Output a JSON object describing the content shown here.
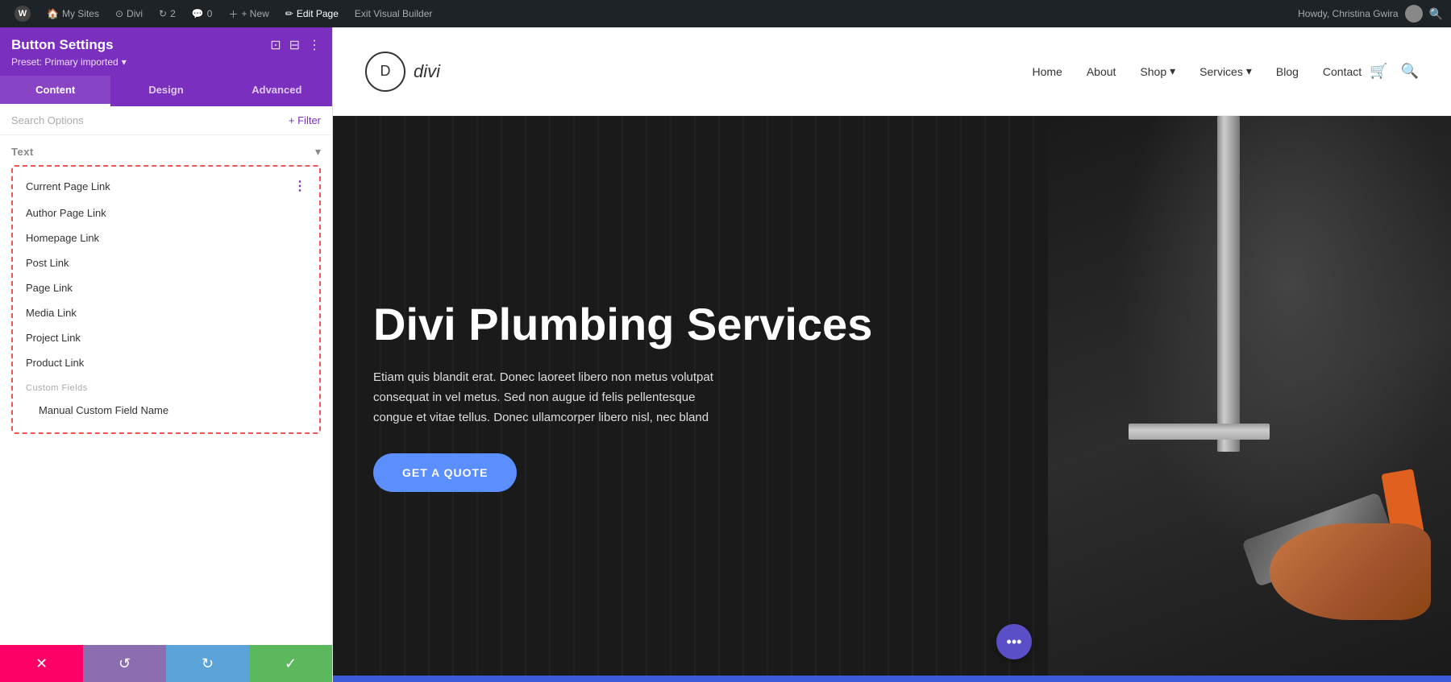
{
  "adminBar": {
    "wpLogo": "W",
    "items": [
      {
        "label": "My Sites",
        "icon": "house"
      },
      {
        "label": "Divi",
        "icon": "divi"
      },
      {
        "label": "2",
        "icon": "loop"
      },
      {
        "label": "0",
        "icon": "comment"
      },
      {
        "label": "+ New",
        "icon": "plus"
      },
      {
        "label": "Edit Page",
        "icon": "pencil"
      },
      {
        "label": "Exit Visual Builder",
        "icon": ""
      }
    ],
    "rightText": "Howdy, Christina Gwira"
  },
  "panel": {
    "title": "Button Settings",
    "preset": "Preset: Primary imported",
    "tabs": [
      {
        "label": "Content",
        "active": true
      },
      {
        "label": "Design",
        "active": false
      },
      {
        "label": "Advanced",
        "active": false
      }
    ],
    "searchPlaceholder": "Search Options",
    "filterLabel": "+ Filter",
    "textSection": {
      "label": "Text",
      "items": [
        {
          "label": "Current Page Link",
          "hasIcon": true
        },
        {
          "label": "Author Page Link",
          "hasIcon": false
        },
        {
          "label": "Homepage Link",
          "hasIcon": false
        },
        {
          "label": "Post Link",
          "hasIcon": false
        },
        {
          "label": "Page Link",
          "hasIcon": false
        },
        {
          "label": "Media Link",
          "hasIcon": false
        },
        {
          "label": "Project Link",
          "hasIcon": false
        },
        {
          "label": "Product Link",
          "hasIcon": false
        }
      ],
      "customFieldsLabel": "Custom Fields",
      "customFieldItems": [
        {
          "label": "Manual Custom Field Name"
        }
      ]
    }
  },
  "bottomButtons": [
    {
      "label": "✕",
      "action": "cancel"
    },
    {
      "label": "↺",
      "action": "undo"
    },
    {
      "label": "↻",
      "action": "redo"
    },
    {
      "label": "✓",
      "action": "save"
    }
  ],
  "siteHeader": {
    "logoSymbol": "D",
    "logoText": "divi",
    "nav": [
      {
        "label": "Home",
        "hasDropdown": false
      },
      {
        "label": "About",
        "hasDropdown": false
      },
      {
        "label": "Shop",
        "hasDropdown": true
      },
      {
        "label": "Services",
        "hasDropdown": true
      },
      {
        "label": "Blog",
        "hasDropdown": false
      },
      {
        "label": "Contact",
        "hasDropdown": false
      }
    ]
  },
  "hero": {
    "title": "Divi Plumbing Services",
    "description": "Etiam quis blandit erat. Donec laoreet libero non metus volutpat consequat in vel metus. Sed non augue id felis pellentesque congue et vitae tellus. Donec ullamcorper libero nisl, nec bland",
    "ctaLabel": "GET A QUOTE",
    "fabLabel": "•••"
  }
}
